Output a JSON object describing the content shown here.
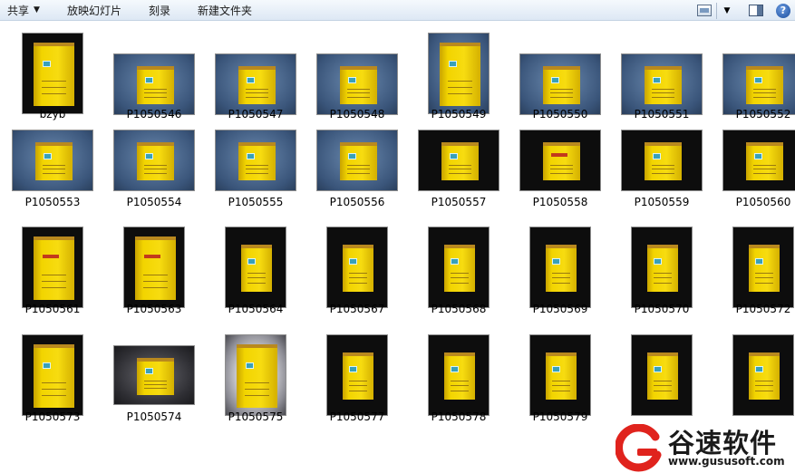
{
  "toolbar": {
    "items": [
      {
        "label": "共享",
        "has_arrow": true
      },
      {
        "label": "放映幻灯片",
        "has_arrow": false
      },
      {
        "label": "刻录",
        "has_arrow": false
      },
      {
        "label": "新建文件夹",
        "has_arrow": false
      }
    ],
    "icons": [
      "view-mode-icon",
      "chevron-down-icon",
      "preview-pane-icon",
      "help-icon"
    ],
    "help_label": "?"
  },
  "files": [
    {
      "name": "bzyb",
      "kind": "black",
      "orient": "portrait"
    },
    {
      "name": "P1050546",
      "kind": "blue",
      "orient": "landscape"
    },
    {
      "name": "P1050547",
      "kind": "blue",
      "orient": "landscape"
    },
    {
      "name": "P1050548",
      "kind": "blue",
      "orient": "landscape"
    },
    {
      "name": "P1050549",
      "kind": "blue",
      "orient": "portrait"
    },
    {
      "name": "P1050550",
      "kind": "blue",
      "orient": "landscape"
    },
    {
      "name": "P1050551",
      "kind": "blue",
      "orient": "landscape"
    },
    {
      "name": "P1050552",
      "kind": "blue",
      "orient": "landscape"
    },
    {
      "name": "P1050553",
      "kind": "blue",
      "orient": "landscape"
    },
    {
      "name": "P1050554",
      "kind": "blue",
      "orient": "landscape"
    },
    {
      "name": "P1050555",
      "kind": "blue",
      "orient": "landscape"
    },
    {
      "name": "P1050556",
      "kind": "blue",
      "orient": "landscape"
    },
    {
      "name": "P1050557",
      "kind": "black",
      "orient": "landscape"
    },
    {
      "name": "P1050558",
      "kind": "black",
      "orient": "landscape"
    },
    {
      "name": "P1050559",
      "kind": "black",
      "orient": "landscape"
    },
    {
      "name": "P1050560",
      "kind": "black",
      "orient": "landscape"
    },
    {
      "name": "P1050561",
      "kind": "black",
      "orient": "portrait"
    },
    {
      "name": "P1050563",
      "kind": "black",
      "orient": "portrait"
    },
    {
      "name": "P1050564",
      "kind": "black",
      "orient": "portrait"
    },
    {
      "name": "P1050567",
      "kind": "black",
      "orient": "portrait"
    },
    {
      "name": "P1050568",
      "kind": "black",
      "orient": "portrait"
    },
    {
      "name": "P1050569",
      "kind": "black",
      "orient": "portrait"
    },
    {
      "name": "P1050570",
      "kind": "black",
      "orient": "portrait"
    },
    {
      "name": "P1050572",
      "kind": "black",
      "orient": "portrait"
    },
    {
      "name": "P1050573",
      "kind": "black",
      "orient": "portrait"
    },
    {
      "name": "P1050574",
      "kind": "dark",
      "orient": "landscape"
    },
    {
      "name": "P1050575",
      "kind": "vign",
      "orient": "portrait"
    },
    {
      "name": "P1050577",
      "kind": "black",
      "orient": "portrait"
    },
    {
      "name": "P1050578",
      "kind": "black",
      "orient": "portrait"
    },
    {
      "name": "P1050579",
      "kind": "black",
      "orient": "portrait"
    },
    {
      "name": "",
      "kind": "black",
      "orient": "portrait"
    },
    {
      "name": "",
      "kind": "black",
      "orient": "portrait"
    }
  ],
  "watermark": {
    "brand": "谷速软件",
    "url": "www.gususoft.com",
    "logo_color": "#e0231d"
  }
}
